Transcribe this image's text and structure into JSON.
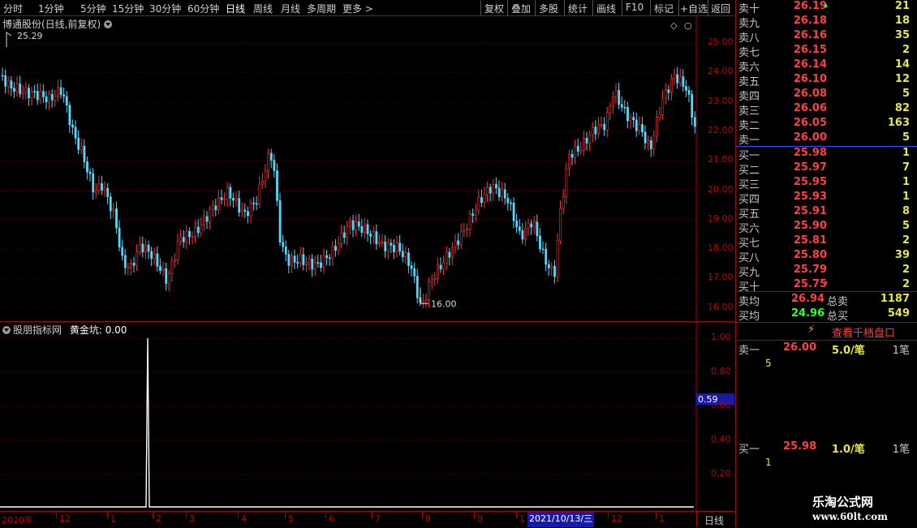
{
  "toolbar": {
    "periods": [
      "分时",
      "1分钟",
      "5分钟",
      "15分钟",
      "30分钟",
      "60分钟",
      "日线",
      "周线",
      "月线",
      "多周期",
      "更多 >"
    ],
    "active_period": "日线",
    "tools": [
      "复权",
      "叠加",
      "多股",
      "统计",
      "画线",
      "F10",
      "标记",
      "+自选",
      "返回"
    ]
  },
  "main_chart": {
    "title": "博通股份(日线,前复权)",
    "high_marker": "25.29",
    "low_marker": "16.00",
    "y_ticks": [
      "25.00",
      "24.00",
      "23.00",
      "22.00",
      "21.00",
      "20.00",
      "19.00",
      "18.00",
      "17.00",
      "16.00"
    ]
  },
  "indicator": {
    "title": "股朋指标网",
    "name": "黄金坑:",
    "value": "0.00",
    "y_ticks": [
      "1.00",
      "0.80",
      "0.60",
      "0.40",
      "0.20"
    ],
    "cursor_value": "0.59"
  },
  "time_axis": {
    "labels": [
      "2020年",
      "12",
      "1",
      "2",
      "3",
      "4",
      "5",
      "6",
      "7",
      "8",
      "9",
      "1",
      "12",
      "1"
    ],
    "cursor_date": "2021/10/13/三",
    "period_button": "日线"
  },
  "order_book": {
    "asks": [
      {
        "name": "卖十",
        "price": "26.19",
        "vol": "21"
      },
      {
        "name": "卖九",
        "price": "26.18",
        "vol": "18"
      },
      {
        "name": "卖八",
        "price": "26.16",
        "vol": "35"
      },
      {
        "name": "卖七",
        "price": "26.15",
        "vol": "2"
      },
      {
        "name": "卖六",
        "price": "26.14",
        "vol": "14"
      },
      {
        "name": "卖五",
        "price": "26.10",
        "vol": "12"
      },
      {
        "name": "卖四",
        "price": "26.08",
        "vol": "5"
      },
      {
        "name": "卖三",
        "price": "26.06",
        "vol": "82"
      },
      {
        "name": "卖二",
        "price": "26.05",
        "vol": "163"
      },
      {
        "name": "卖一",
        "price": "26.00",
        "vol": "5"
      }
    ],
    "bids": [
      {
        "name": "买一",
        "price": "25.98",
        "vol": "1"
      },
      {
        "name": "买二",
        "price": "25.97",
        "vol": "7"
      },
      {
        "name": "买三",
        "price": "25.95",
        "vol": "1"
      },
      {
        "name": "买四",
        "price": "25.93",
        "vol": "1"
      },
      {
        "name": "买五",
        "price": "25.91",
        "vol": "8"
      },
      {
        "name": "买六",
        "price": "25.90",
        "vol": "5"
      },
      {
        "name": "买七",
        "price": "25.81",
        "vol": "2"
      },
      {
        "name": "买八",
        "price": "25.80",
        "vol": "39"
      },
      {
        "name": "买九",
        "price": "25.79",
        "vol": "2"
      },
      {
        "name": "买十",
        "price": "25.75",
        "vol": "2"
      }
    ],
    "ask_avg_label": "卖均",
    "ask_avg": "26.94",
    "ask_total_label": "总卖",
    "ask_total": "1187",
    "bid_avg_label": "买均",
    "bid_avg": "24.96",
    "bid_total_label": "总买",
    "bid_total": "549",
    "view_thousand": "查看千档盘口",
    "detail_ask": {
      "name": "卖一",
      "price": "26.00",
      "avg": "5.0/笔",
      "count": "1笔",
      "qty": "5"
    },
    "detail_bid": {
      "name": "买一",
      "price": "25.98",
      "avg": "1.0/笔",
      "count": "1笔",
      "qty": "1"
    }
  },
  "watermark": {
    "name": "乐淘公式网",
    "url": "www.60lt.com"
  }
}
